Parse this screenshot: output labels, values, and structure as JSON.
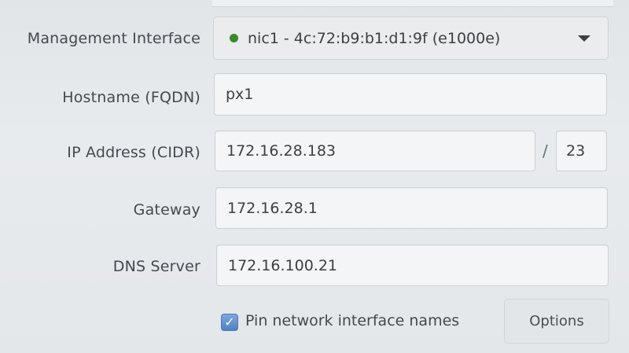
{
  "form": {
    "management_interface": {
      "label": "Management Interface",
      "value": "nic1 - 4c:72:b9:b1:d1:9f (e1000e)",
      "status_color": "#3a8a2e"
    },
    "hostname": {
      "label": "Hostname (FQDN)",
      "value": "px1"
    },
    "ip_address": {
      "label": "IP Address (CIDR)",
      "value": "172.16.28.183",
      "separator": "/",
      "prefix": "23"
    },
    "gateway": {
      "label": "Gateway",
      "value": "172.16.28.1"
    },
    "dns_server": {
      "label": "DNS Server",
      "value": "172.16.100.21"
    },
    "pin_names": {
      "label": "Pin network interface names",
      "checked": true
    },
    "options_button": {
      "label": "Options"
    }
  }
}
